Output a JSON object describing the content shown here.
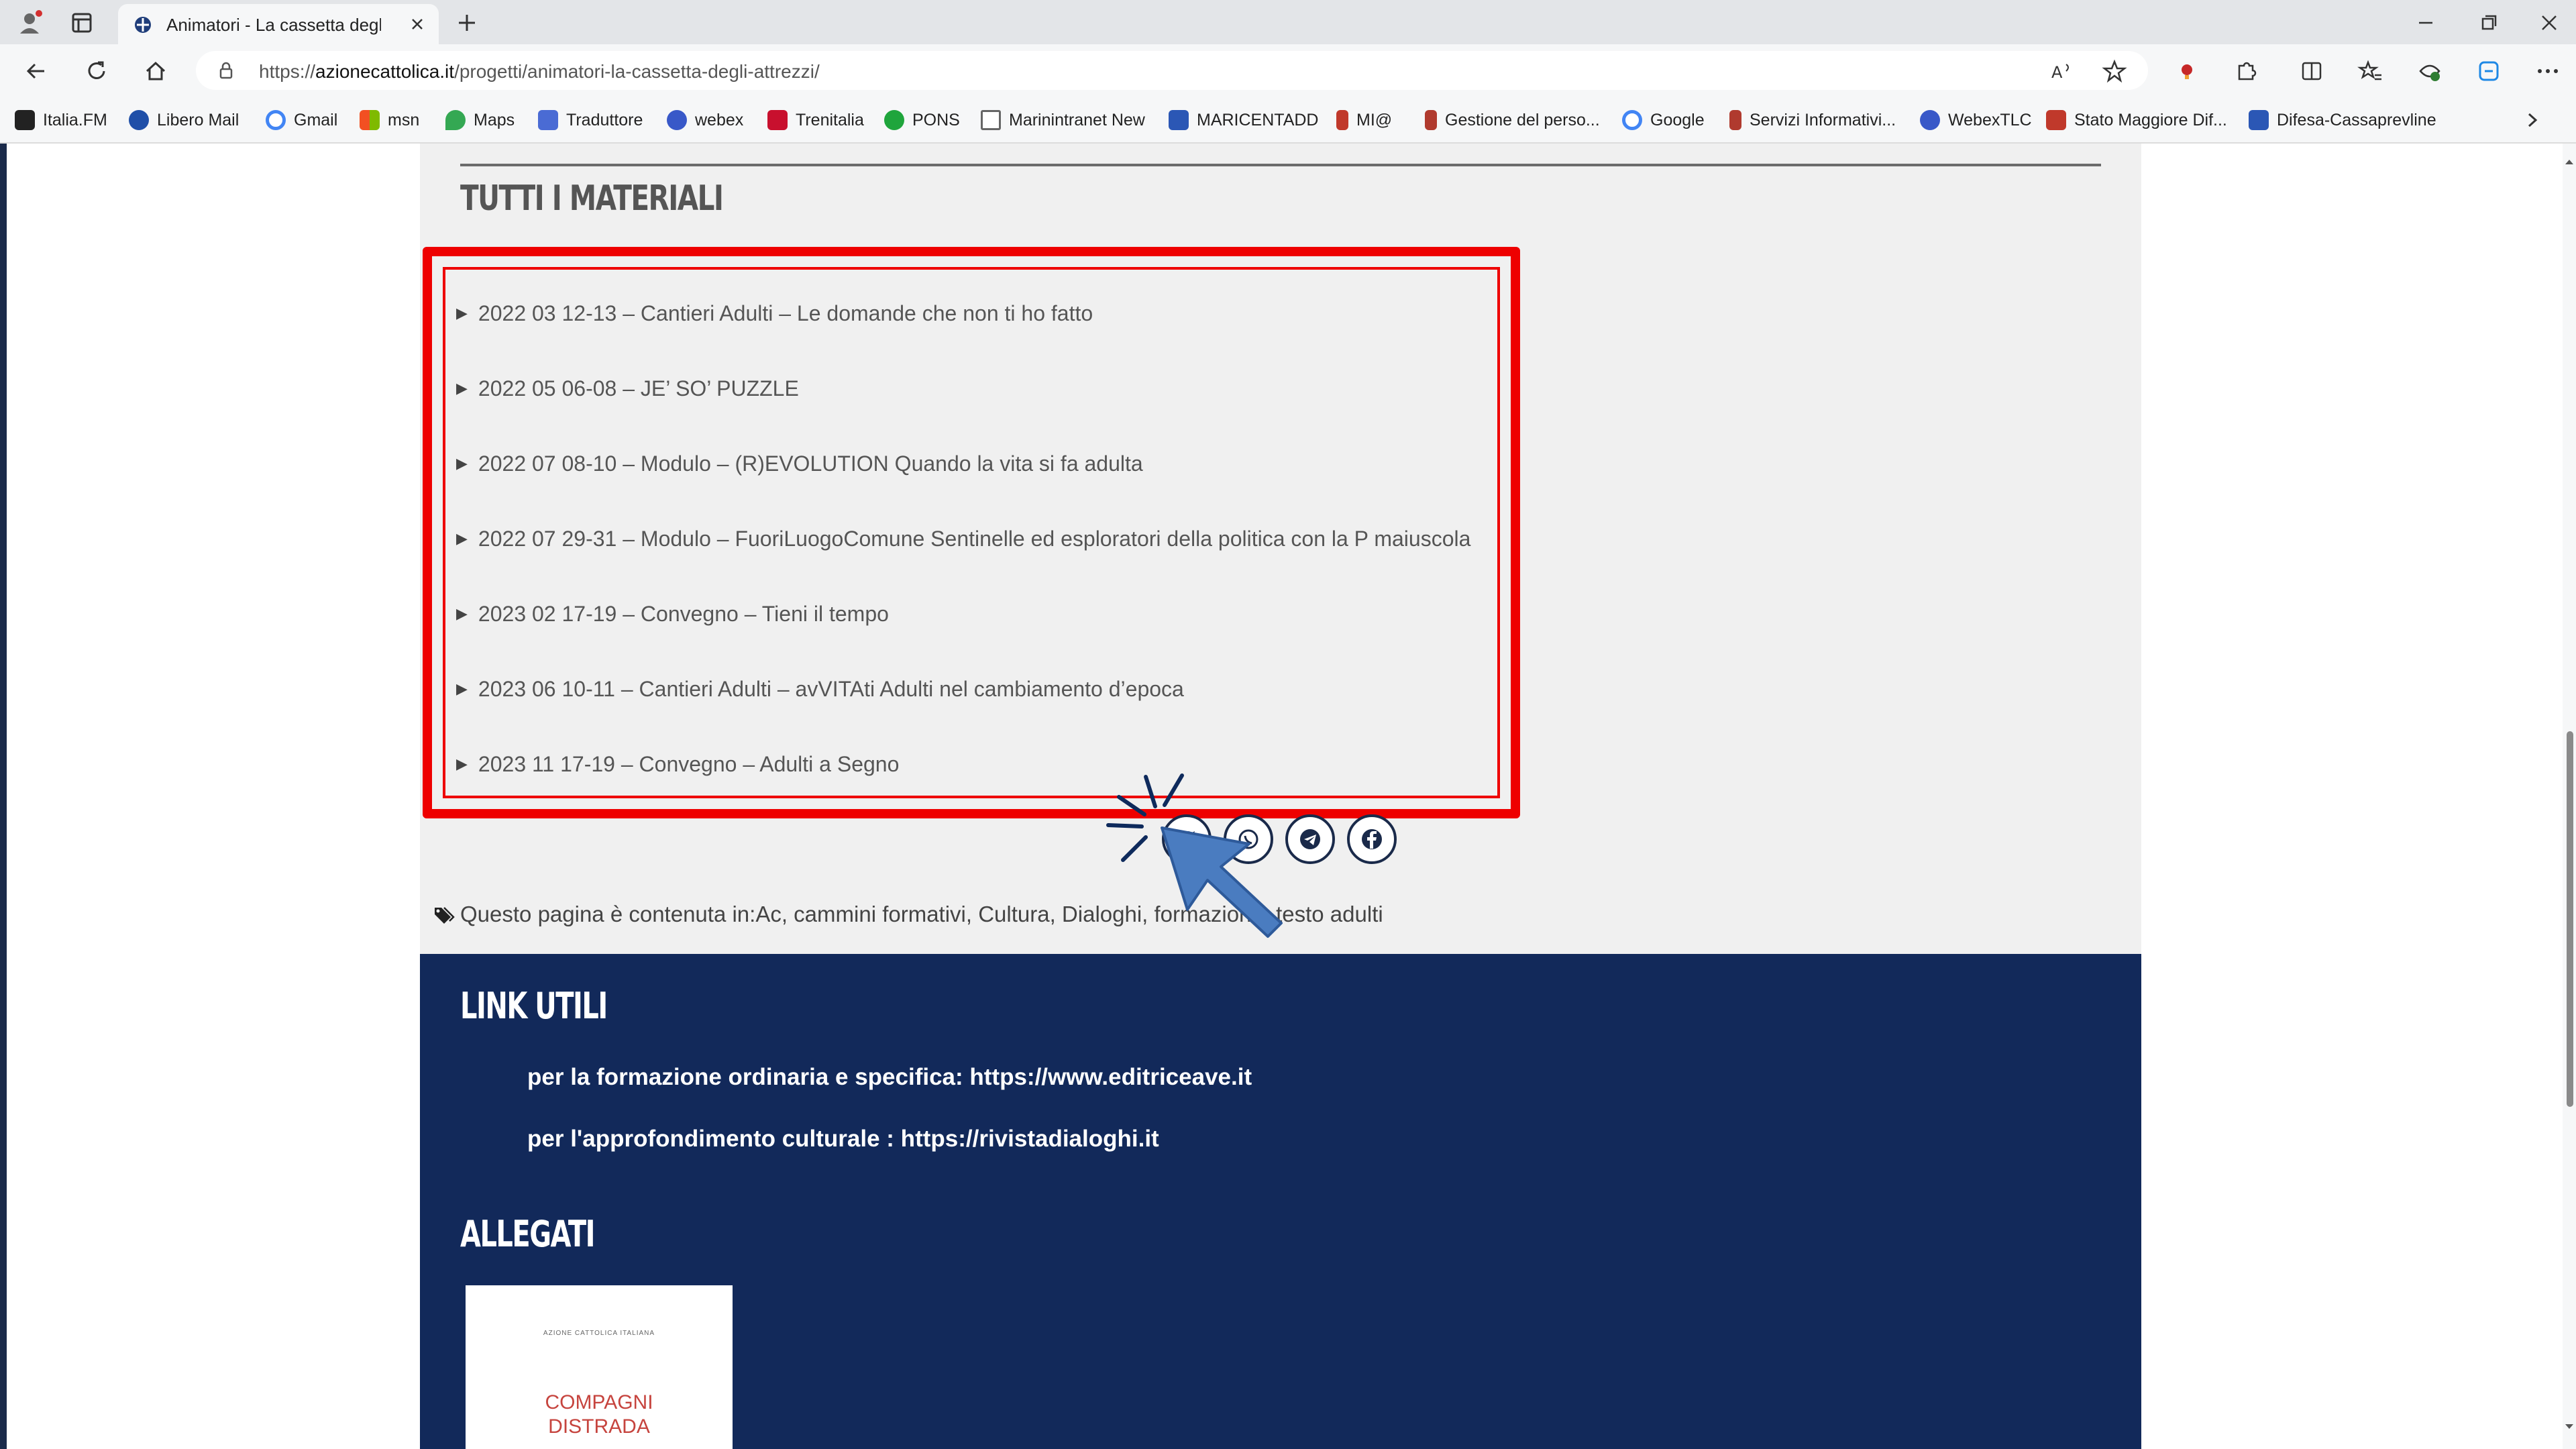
{
  "browser": {
    "tab_title": "Animatori - La cassetta degli attrezzi",
    "url_prefix": "https://",
    "url_host": "azionecattolica.it",
    "url_path": "/progetti/animatori-la-cassetta-degli-attrezzi/"
  },
  "bookmarks": [
    {
      "label": "Italia.FM",
      "color": "#222222"
    },
    {
      "label": "Libero Mail",
      "color": "#1f4fa8"
    },
    {
      "label": "Gmail",
      "color": "#4285f4"
    },
    {
      "label": "msn",
      "color": "#f25022"
    },
    {
      "label": "Maps",
      "color": "#34a853"
    },
    {
      "label": "Traduttore",
      "color": "#4a6bd4"
    },
    {
      "label": "webex",
      "color": "#3858c8"
    },
    {
      "label": "Trenitalia",
      "color": "#c8102e"
    },
    {
      "label": "PONS",
      "color": "#1fa53c"
    },
    {
      "label": "Marinintranet New",
      "color": "#777777"
    },
    {
      "label": "MARICENTADD",
      "color": "#2b57b5"
    },
    {
      "label": "MI@",
      "color": "#c0392b"
    },
    {
      "label": "Gestione del perso...",
      "color": "#b03a2e"
    },
    {
      "label": "Google",
      "color": "#4285f4"
    },
    {
      "label": "Servizi Informativi...",
      "color": "#b03a2e"
    },
    {
      "label": "WebexTLC",
      "color": "#3858c8"
    },
    {
      "label": "Stato Maggiore Dif...",
      "color": "#c0392b"
    },
    {
      "label": "Difesa-Cassaprevline",
      "color": "#2b57b5"
    }
  ],
  "page": {
    "section_title": "TUTTI I MATERIALI",
    "materials": [
      "2022 03 12-13 – Cantieri Adulti – Le domande che non ti ho fatto",
      "2022 05 06-08 – JE’ SO’ PUZZLE",
      "2022 07 08-10 – Modulo – (R)EVOLUTION Quando la vita si fa adulta",
      "2022 07 29-31 – Modulo – FuoriLuogoComune Sentinelle ed esploratori della politica con la P maiuscola",
      "2023 02 17-19 – Convegno – Tieni il tempo",
      "2023 06 10-11 – Cantieri Adulti – avVITAti Adulti nel cambiamento d’epoca",
      "2023 11 17-19 – Convegno – Adulti a Segno"
    ],
    "share_icons": [
      "twitter-icon",
      "whatsapp-icon",
      "telegram-icon",
      "facebook-icon"
    ],
    "tags_prefix": "Questo pagina è contenuta in: ",
    "tags": "Ac, cammini formativi, Cultura, Dialoghi, formazione, testo adulti"
  },
  "footer": {
    "link_title": "LINK UTILI",
    "link_1": "per la formazione ordinaria e specifica: https://www.editriceave.it",
    "link_2": "per l'approfondimento culturale : https://rivistadialoghi.it",
    "attach_title": "ALLEGATI",
    "attach_small": "AZIONE CATTOLICA ITALIANA",
    "attach_line1": "COMPAGNI",
    "attach_line2": "DISTRADA"
  },
  "colors": {
    "highlight": "#ee0000",
    "footer_bg": "#12295a",
    "cursor": "#4a7cc0"
  }
}
